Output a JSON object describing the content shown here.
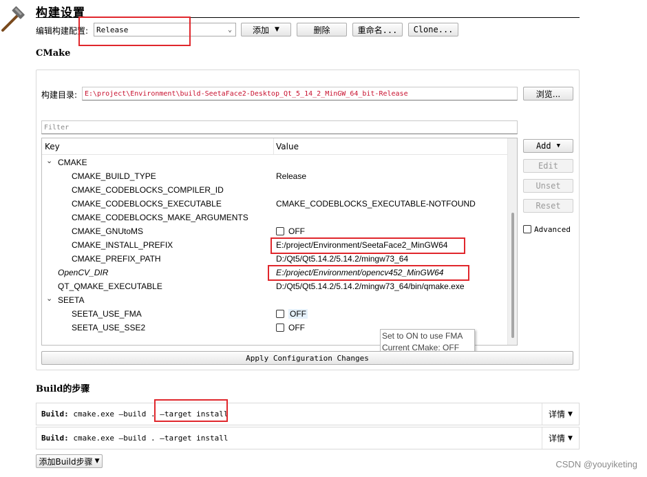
{
  "header": {
    "title": "构建设置"
  },
  "config": {
    "label": "编辑构建配置:",
    "selected": "Release",
    "add_label": "添加",
    "delete_label": "删除",
    "rename_label": "重命名...",
    "clone_label": "Clone..."
  },
  "cmake": {
    "section_title": "CMake",
    "build_dir_label": "构建目录:",
    "build_dir_value": "E:\\project\\Environment\\build-SeetaFace2-Desktop_Qt_5_14_2_MinGW_64_bit-Release",
    "browse_label": "浏览...",
    "filter_placeholder": "Filter",
    "col_key": "Key",
    "col_value": "Value",
    "rows": [
      {
        "key": "CMAKE",
        "value": ""
      },
      {
        "key": "CMAKE_BUILD_TYPE",
        "value": "Release"
      },
      {
        "key": "CMAKE_CODEBLOCKS_COMPILER_ID",
        "value": ""
      },
      {
        "key": "CMAKE_CODEBLOCKS_EXECUTABLE",
        "value": "CMAKE_CODEBLOCKS_EXECUTABLE-NOTFOUND"
      },
      {
        "key": "CMAKE_CODEBLOCKS_MAKE_ARGUMENTS",
        "value": ""
      },
      {
        "key": "CMAKE_GNUtoMS",
        "value": "OFF"
      },
      {
        "key": "CMAKE_INSTALL_PREFIX",
        "value": "E:/project/Environment/SeetaFace2_MinGW64"
      },
      {
        "key": "CMAKE_PREFIX_PATH",
        "value": "D:/Qt5/Qt5.14.2/5.14.2/mingw73_64"
      },
      {
        "key": "OpenCV_DIR",
        "value": "E:/project/Environment/opencv452_MinGW64"
      },
      {
        "key": "QT_QMAKE_EXECUTABLE",
        "value": "D:/Qt5/Qt5.14.2/5.14.2/mingw73_64/bin/qmake.exe"
      },
      {
        "key": "SEETA",
        "value": ""
      },
      {
        "key": "SEETA_USE_FMA",
        "value": "OFF"
      },
      {
        "key": "SEETA_USE_SSE2",
        "value": "OFF"
      }
    ],
    "side_buttons": {
      "add": "Add",
      "edit": "Edit",
      "unset": "Unset",
      "reset": "Reset"
    },
    "advanced_label": "Advanced",
    "tooltip_line1": "Set to ON to use FMA",
    "tooltip_line2": "Current CMake: OFF",
    "apply_label": "Apply Configuration Changes"
  },
  "build": {
    "section_title": "Build的步骤",
    "steps": [
      {
        "prefix": "Build:",
        "command": "cmake.exe —build . —target install",
        "details": "详情"
      },
      {
        "prefix": "Build:",
        "command": "cmake.exe —build . —target install",
        "details": "详情"
      }
    ],
    "add_step_label": "添加Build步骤"
  },
  "watermark": "CSDN @youyiketing",
  "colors": {
    "highlight_red": "#e0262b",
    "path_red": "#c8102e"
  }
}
